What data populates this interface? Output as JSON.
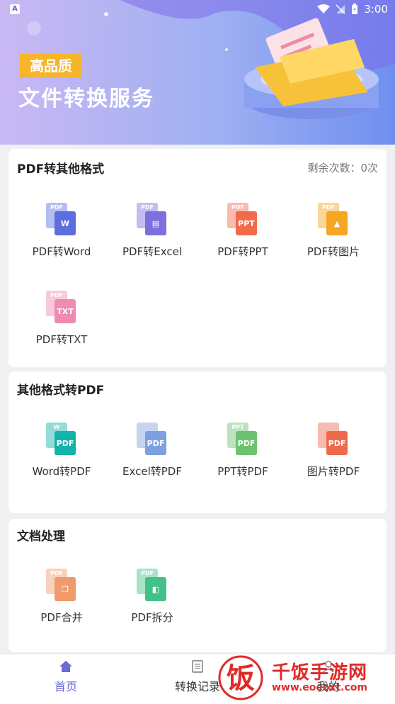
{
  "status_bar": {
    "time": "3:00"
  },
  "banner": {
    "badge": "高品质",
    "headline": "文件转换服务"
  },
  "section_pdf_to_other": {
    "title": "PDF转其他格式",
    "remaining": "剩余次数：0次",
    "tools": [
      {
        "label": "PDF转Word",
        "icon": "pdf-to-word-icon",
        "back_text": "PDF",
        "front_text": "W",
        "color": "#5b6ee0"
      },
      {
        "label": "PDF转Excel",
        "icon": "pdf-to-excel-icon",
        "back_text": "PDF",
        "front_text": "▤",
        "color": "#7c6fe0"
      },
      {
        "label": "PDF转PPT",
        "icon": "pdf-to-ppt-icon",
        "back_text": "PDF",
        "front_text": "PPT",
        "color": "#f06b4c"
      },
      {
        "label": "PDF转图片",
        "icon": "pdf-to-image-icon",
        "back_text": "PDF",
        "front_text": "▲",
        "color": "#f5a623"
      },
      {
        "label": "PDF转TXT",
        "icon": "pdf-to-txt-icon",
        "back_text": "PDF",
        "front_text": "TXT",
        "color": "#ef8ab0"
      }
    ]
  },
  "section_other_to_pdf": {
    "title": "其他格式转PDF",
    "tools": [
      {
        "label": "Word转PDF",
        "icon": "word-to-pdf-icon",
        "back_text": "W",
        "front_text": "PDF",
        "color": "#12b3a8"
      },
      {
        "label": "Excel转PDF",
        "icon": "excel-to-pdf-icon",
        "back_text": "",
        "front_text": "PDF",
        "color": "#7e9fe0"
      },
      {
        "label": "PPT转PDF",
        "icon": "ppt-to-pdf-icon",
        "back_text": "PPT",
        "front_text": "PDF",
        "color": "#6cc270"
      },
      {
        "label": "图片转PDF",
        "icon": "image-to-pdf-icon",
        "back_text": "",
        "front_text": "PDF",
        "color": "#ee6a4e"
      }
    ]
  },
  "section_doc_process": {
    "title": "文档处理",
    "tools": [
      {
        "label": "PDF合并",
        "icon": "pdf-merge-icon",
        "back_text": "PDF",
        "front_text": "❐",
        "color": "#f19a6c"
      },
      {
        "label": "PDF拆分",
        "icon": "pdf-split-icon",
        "back_text": "PDF",
        "front_text": "◧",
        "color": "#42c28a"
      }
    ]
  },
  "bottom_nav": {
    "items": [
      {
        "label": "首页",
        "icon": "home-icon"
      },
      {
        "label": "转换记录",
        "icon": "document-list-icon"
      },
      {
        "label": "我的",
        "icon": "profile-icon"
      }
    ]
  },
  "watermark": {
    "text": "千饭手游网",
    "url": "www.eoeoxt.com",
    "logo_char": "饭"
  },
  "colors": {
    "accent": "#6b6bd6",
    "badge": "#f7b52c",
    "watermark": "#e02a2a"
  }
}
